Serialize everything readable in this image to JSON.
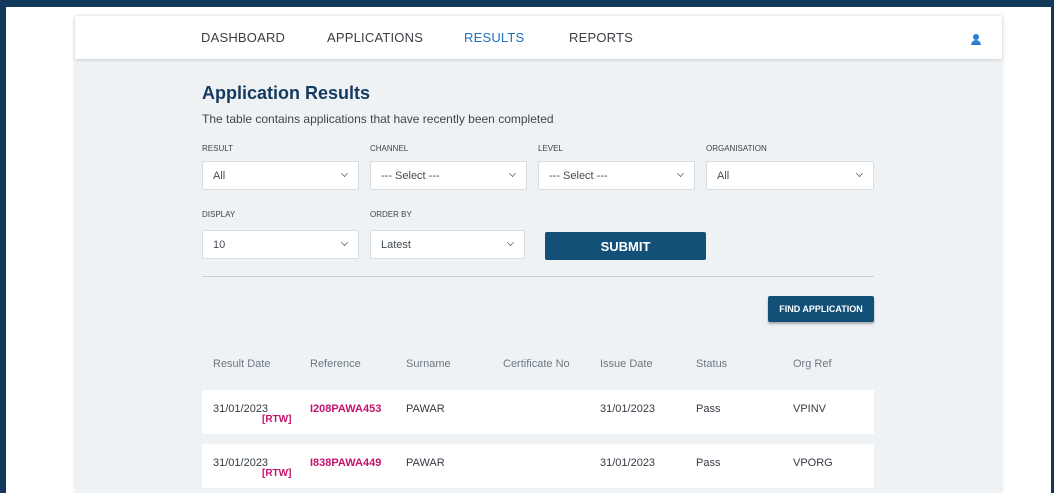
{
  "nav": {
    "items": [
      {
        "label": "DASHBOARD",
        "active": false
      },
      {
        "label": "APPLICATIONS",
        "active": false
      },
      {
        "label": "RESULTS",
        "active": true
      },
      {
        "label": "REPORTS",
        "active": false
      }
    ],
    "user_icon": "user-icon"
  },
  "header": {
    "title": "Application Results",
    "subtitle": "The table contains applications that have recently been completed"
  },
  "filters": {
    "result": {
      "label": "RESULT",
      "value": "All"
    },
    "channel": {
      "label": "CHANNEL",
      "value": "--- Select ---"
    },
    "level": {
      "label": "LEVEL",
      "value": "--- Select ---"
    },
    "organisation": {
      "label": "ORGANISATION",
      "value": "All"
    },
    "display": {
      "label": "DISPLAY",
      "value": "10"
    },
    "order_by": {
      "label": "ORDER BY",
      "value": "Latest"
    },
    "submit_label": "SUBMIT"
  },
  "actions": {
    "find_label": "FIND APPLICATION"
  },
  "table": {
    "columns": [
      "Result Date",
      "Reference",
      "Surname",
      "Certificate No",
      "Issue Date",
      "Status",
      "Org Ref"
    ],
    "rows": [
      {
        "result_date": "31/01/2023",
        "tag": "[RTW]",
        "reference": "I208PAWA453",
        "surname": "PAWAR",
        "certificate_no": "",
        "issue_date": "31/01/2023",
        "status": "Pass",
        "org_ref": "VPINV"
      },
      {
        "result_date": "31/01/2023",
        "tag": "[RTW]",
        "reference": "I838PAWA449",
        "surname": "PAWAR",
        "certificate_no": "",
        "issue_date": "31/01/2023",
        "status": "Pass",
        "org_ref": "VPORG"
      }
    ]
  },
  "colors": {
    "brand_dark": "#12385c",
    "button": "#135078",
    "active_nav": "#1f6fc1",
    "reference_link": "#c4136d",
    "background": "#eef2f4"
  }
}
